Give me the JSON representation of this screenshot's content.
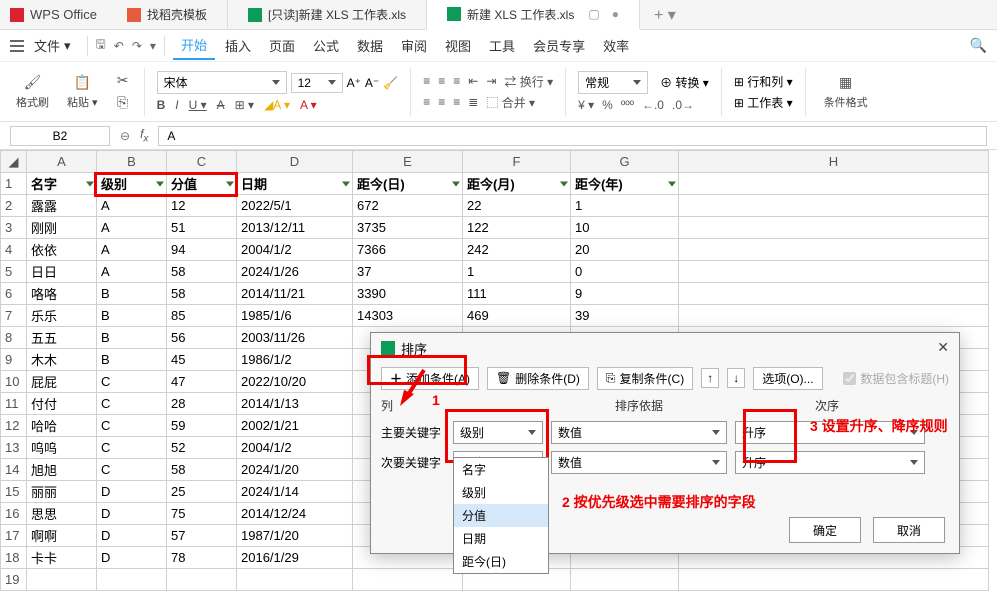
{
  "app": {
    "name": "WPS Office"
  },
  "tabs": [
    {
      "label": "找稻壳模板",
      "type": "d"
    },
    {
      "label": "[只读]新建 XLS 工作表.xls",
      "type": "s"
    },
    {
      "label": "新建 XLS 工作表.xls",
      "type": "s",
      "active": true
    }
  ],
  "menu": {
    "file": "文件",
    "items": [
      "开始",
      "插入",
      "页面",
      "公式",
      "数据",
      "审阅",
      "视图",
      "工具",
      "会员专享",
      "效率"
    ]
  },
  "ribbon": {
    "brush": "格式刷",
    "paste": "粘贴",
    "font": "宋体",
    "size": "12",
    "wrap": "换行",
    "merge": "合并",
    "general": "常规",
    "convert": "转换",
    "rowcol": "行和列",
    "worksheet": "工作表",
    "condfmt": "条件格式"
  },
  "fx": {
    "cell": "B2",
    "value": "A"
  },
  "sheet": {
    "headers": [
      "名字",
      "级别",
      "分值",
      "日期",
      "距今(日)",
      "距今(月)",
      "距今(年)"
    ],
    "rows": [
      [
        "露露",
        "A",
        "12",
        "2022/5/1",
        "672",
        "22",
        "1"
      ],
      [
        "刚刚",
        "A",
        "51",
        "2013/12/11",
        "3735",
        "122",
        "10"
      ],
      [
        "依依",
        "A",
        "94",
        "2004/1/2",
        "7366",
        "242",
        "20"
      ],
      [
        "日日",
        "A",
        "58",
        "2024/1/26",
        "37",
        "1",
        "0"
      ],
      [
        "咯咯",
        "B",
        "58",
        "2014/11/21",
        "3390",
        "111",
        "9"
      ],
      [
        "乐乐",
        "B",
        "85",
        "1985/1/6",
        "14303",
        "469",
        "39"
      ],
      [
        "五五",
        "B",
        "56",
        "2003/11/26",
        "",
        "",
        ""
      ],
      [
        "木木",
        "B",
        "45",
        "1986/1/2",
        "",
        "",
        ""
      ],
      [
        "屁屁",
        "C",
        "47",
        "2022/10/20",
        "",
        "",
        ""
      ],
      [
        "付付",
        "C",
        "28",
        "2014/1/13",
        "",
        "",
        ""
      ],
      [
        "哈哈",
        "C",
        "59",
        "2002/1/21",
        "",
        "",
        ""
      ],
      [
        "呜呜",
        "C",
        "52",
        "2004/1/2",
        "",
        "",
        ""
      ],
      [
        "旭旭",
        "C",
        "58",
        "2024/1/20",
        "",
        "",
        ""
      ],
      [
        "丽丽",
        "D",
        "25",
        "2024/1/14",
        "",
        "",
        ""
      ],
      [
        "思思",
        "D",
        "75",
        "2014/12/24",
        "",
        "",
        ""
      ],
      [
        "啊啊",
        "D",
        "57",
        "1987/1/20",
        "",
        "",
        ""
      ],
      [
        "卡卡",
        "D",
        "78",
        "2016/1/29",
        "",
        "",
        ""
      ]
    ]
  },
  "dialog": {
    "title": "排序",
    "add": "添加条件(A)",
    "del": "删除条件(D)",
    "copy": "复制条件(C)",
    "options": "选项(O)...",
    "header_chk": "数据包含标题(H)",
    "col_head": "列",
    "basis_head": "排序依据",
    "order_head": "次序",
    "row1": {
      "label": "主要关键字",
      "field": "级别",
      "basis": "数值",
      "order": "升序"
    },
    "row2": {
      "label": "次要关键字",
      "field": "分值",
      "basis": "数值",
      "order": "升序"
    },
    "dropdown": [
      "名字",
      "级别",
      "分值",
      "日期",
      "距今(日)"
    ],
    "ok": "确定",
    "cancel": "取消"
  },
  "anno": {
    "n1": "1",
    "n2": "2 按优先级选中需要排序的字段",
    "n3": "3 设置升序、降序规则"
  }
}
